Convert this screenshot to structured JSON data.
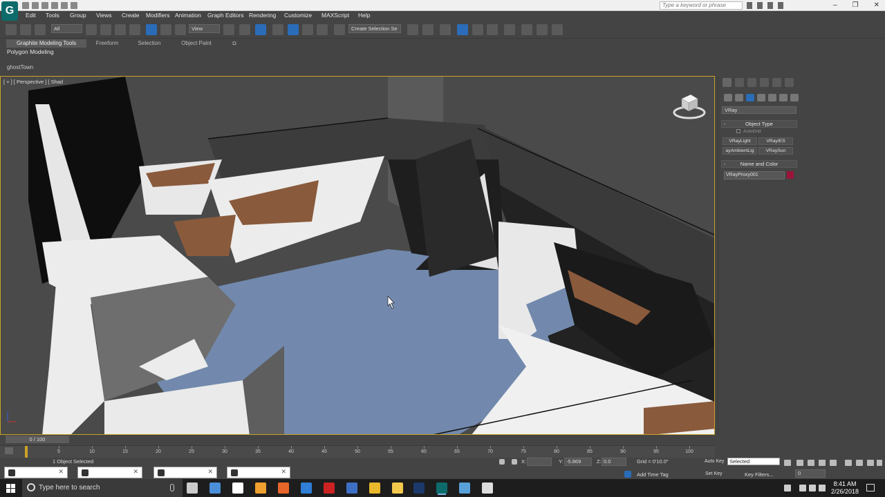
{
  "title_bar": {
    "search_placeholder": "Type a keyword or phrase",
    "minimize": "–",
    "restore": "❐",
    "close": "✕"
  },
  "app_logo": "G",
  "menu": [
    "Edit",
    "Tools",
    "Group",
    "Views",
    "Create",
    "Modifiers",
    "Animation",
    "Graph Editors",
    "Rendering",
    "Customize",
    "MAXScript",
    "Help"
  ],
  "toolbar": {
    "selection_filter": "All",
    "reference_coord": "View",
    "named_selection_placeholder": "Create Selection Se"
  },
  "ribbon": {
    "tabs": [
      "Graphite Modeling Tools",
      "Freeform",
      "Selection",
      "Object Paint"
    ],
    "panel_label": "Polygon Modeling"
  },
  "scene_tab": "ghostTown",
  "viewport": {
    "label": "[ + ] [ Perspective ] [ Shad"
  },
  "command_panel": {
    "category_dropdown": "VRay",
    "object_type_header": "Object Type",
    "autogrid_label": "AutoGrid",
    "buttons": [
      "VRayLight",
      "VRayIES",
      "ayAmbientLig",
      "VRaySun"
    ],
    "name_color_header": "Name and Color",
    "object_name": "VRayProxy001",
    "object_color": "#9a1439"
  },
  "timeline": {
    "frame_counter": "0 / 100",
    "ticks": [
      "5",
      "10",
      "15",
      "20",
      "25",
      "30",
      "35",
      "40",
      "45",
      "50",
      "55",
      "60",
      "65",
      "70",
      "75",
      "80",
      "85",
      "90",
      "95",
      "100"
    ]
  },
  "status": {
    "selection_text": "1 Object Selected",
    "x_label": "X:",
    "x_value": "",
    "y_label": "Y:",
    "y_value": "-5.869",
    "z_label": "Z:",
    "z_value": "0.0",
    "grid_text": "Grid = 0'10.0\"",
    "add_time_tag": "Add Time Tag",
    "auto_key_label": "Auto Key",
    "set_key_label": "Set Key",
    "key_mode": "Selected",
    "key_filters": "Key Filters...",
    "current_frame": "0"
  },
  "taskbar": {
    "search_text": "Type here to search",
    "time": "8:41 AM",
    "date": "2/26/2018",
    "apps": [
      {
        "name": "task-view",
        "color": "#cccccc"
      },
      {
        "name": "store",
        "color": "#4a8fd8"
      },
      {
        "name": "camera",
        "color": "#ffffff"
      },
      {
        "name": "media",
        "color": "#f0a030"
      },
      {
        "name": "firefox",
        "color": "#e8662a"
      },
      {
        "name": "edge",
        "color": "#2f7fd6"
      },
      {
        "name": "vray",
        "color": "#c22"
      },
      {
        "name": "photos",
        "color": "#3d6fc4"
      },
      {
        "name": "chrome",
        "color": "#e9b82c"
      },
      {
        "name": "explorer",
        "color": "#f2c94c"
      },
      {
        "name": "photoshop",
        "color": "#1b3a6b"
      },
      {
        "name": "3dsmax",
        "color": "#0e6b6b"
      },
      {
        "name": "monitor",
        "color": "#5aa0d8"
      },
      {
        "name": "image",
        "color": "#dddddd"
      }
    ]
  },
  "colors": {
    "viewport_border": "#c9a227",
    "accent_blue": "#2a6cb8",
    "floor_blue": "#7289ad"
  }
}
